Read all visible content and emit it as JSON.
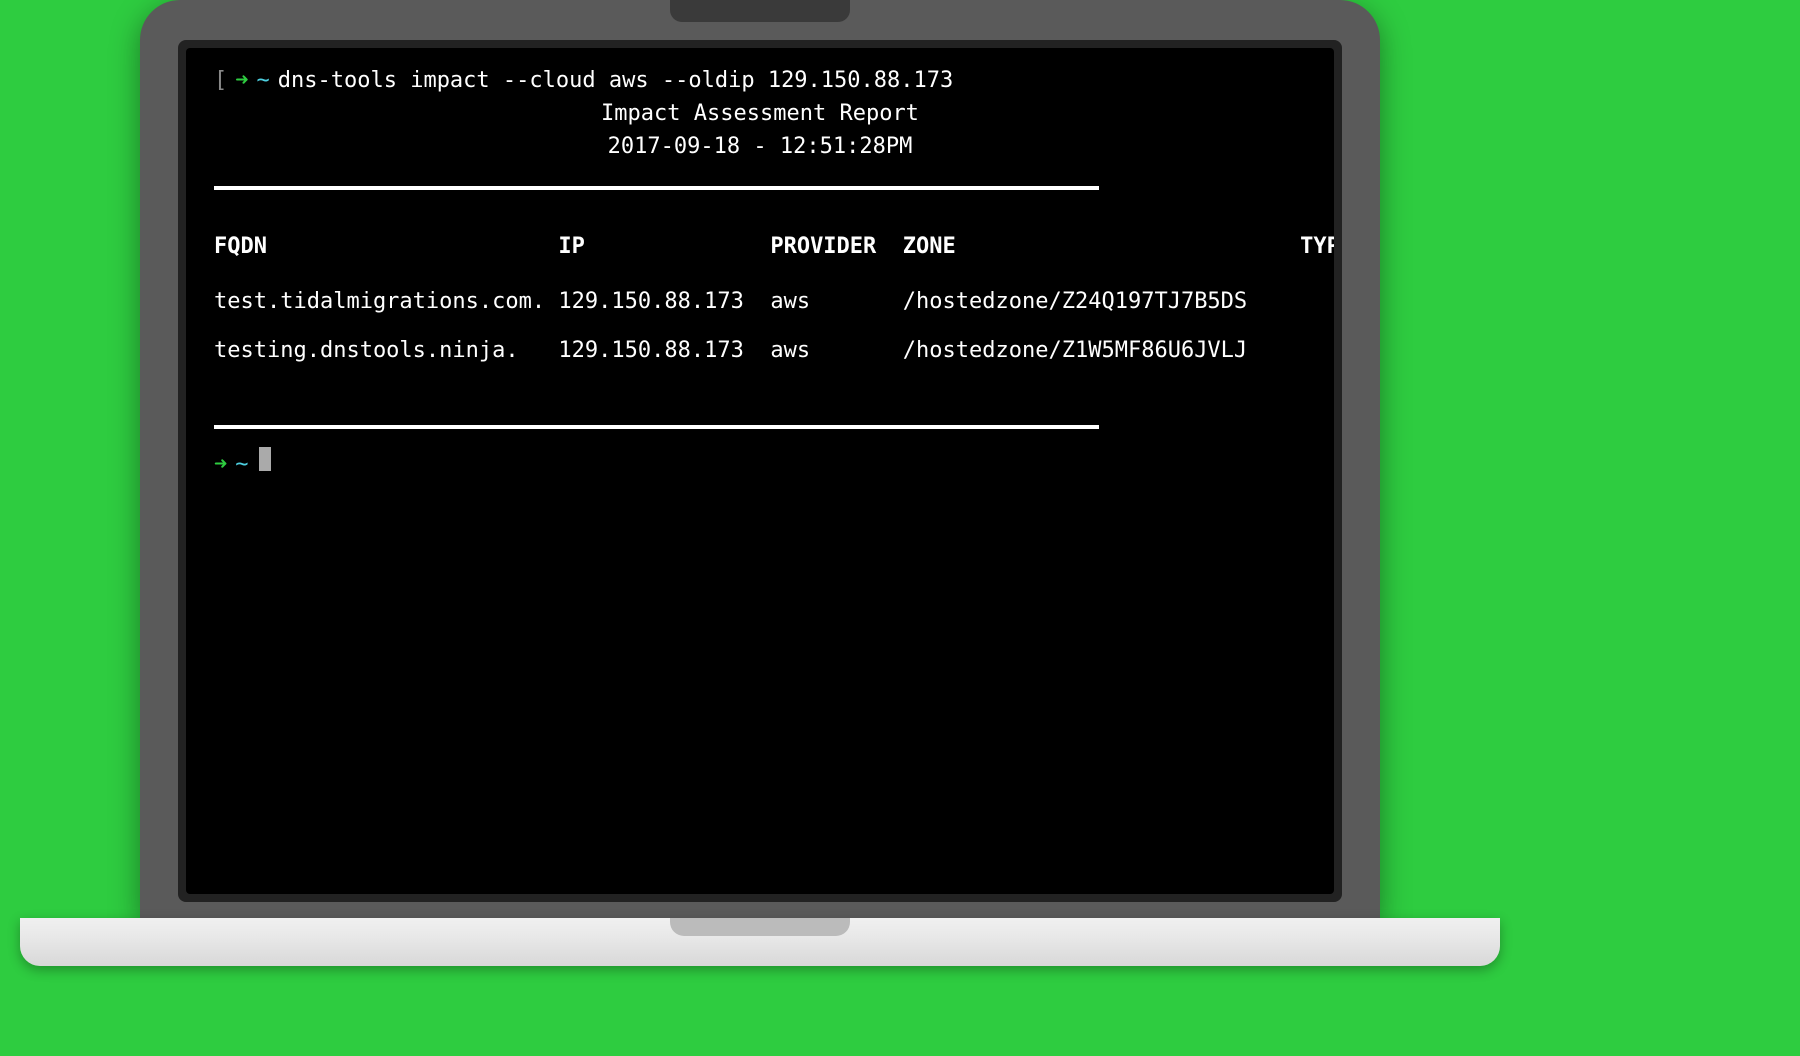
{
  "prompt": {
    "bracket_open": "[",
    "arrow": "➜",
    "tilde": "~",
    "command": "dns-tools impact --cloud aws --oldip 129.150.88.173"
  },
  "report": {
    "title": "Impact Assessment Report",
    "timestamp": "2017-09-18 - 12:51:28PM"
  },
  "table": {
    "headers": {
      "fqdn": "FQDN",
      "ip": "IP",
      "provider": "PROVIDER",
      "zone": "ZONE",
      "type": "TYPE"
    },
    "rows": [
      {
        "fqdn": "test.tidalmigrations.com.",
        "ip": "129.150.88.173",
        "provider": "aws",
        "zone": "/hostedzone/Z24Q197TJ7B5DS",
        "type": ""
      },
      {
        "fqdn": "testing.dnstools.ninja.",
        "ip": "129.150.88.173",
        "provider": "aws",
        "zone": "/hostedzone/Z1W5MF86U6JVLJ",
        "type": ""
      }
    ]
  },
  "prompt2": {
    "arrow": "➜",
    "tilde": "~"
  }
}
